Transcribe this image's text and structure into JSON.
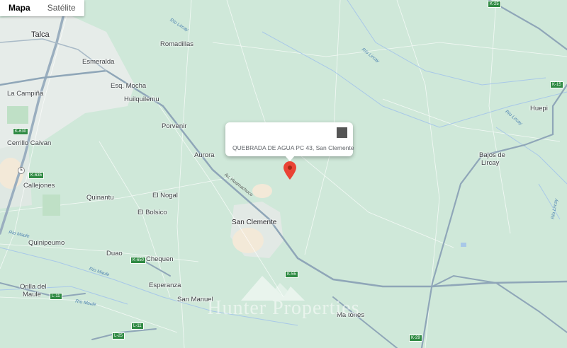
{
  "map_type": {
    "options": [
      "Mapa",
      "Satélite"
    ],
    "selected": "Mapa"
  },
  "info_window": {
    "text": "QUEBRADA DE AGUA PC 43, San Clemente"
  },
  "marker": {
    "color": "#ea4335"
  },
  "watermark": {
    "text": "Hunter Properties"
  },
  "places": {
    "talca": "Talca",
    "romadillas": "Romadillas",
    "esmeralda": "Esmeralda",
    "esq_mocha": "Esq. Mocha",
    "la_campina": "La Campiña",
    "huilquilemu": "Huilquilemu",
    "porvenir": "Porvenir",
    "cerrillo": "Cerrillo Caivan",
    "aurora": "Aurora",
    "huepi": "Huepi",
    "bajos": "Bajos de",
    "lircay": "Lircay",
    "callejones": "Callejones",
    "el_nogal": "El Nogal",
    "quinantu": "Quinantu",
    "el_bolsico": "El Bolsico",
    "san_clemente": "San Clemente",
    "quinipeumo": "Quinipeumo",
    "duao": "Duao",
    "chequen": "Chequen",
    "esperanza": "Esperanza",
    "orilla_del": "Orilla del",
    "maule": "Maule",
    "san_manuel": "San Manuel",
    "matones": "Ma tones"
  },
  "rivers": {
    "lircay1": "Río Lircay",
    "lircay2": "Río Lircay",
    "lircay3": "Río Lircay",
    "lircay4": "Río Lircay",
    "maule1": "Río Maule",
    "maule2": "Río Maule",
    "maule3": "Río Maule"
  },
  "roads": {
    "huamachuco": "Av. Huamachuco"
  },
  "shields": {
    "k25": "K-25",
    "k15": "K-15",
    "k630": "K-630",
    "k635": "K-635",
    "r5": "5",
    "k650": "K-650",
    "l11a": "L-11",
    "l11b": "L-11",
    "l25": "L-25",
    "k55": "K-55",
    "k29": "K-29"
  },
  "colors": {
    "land": "#cfe8d9",
    "urban": "#eaeeed",
    "road_major": "#8fa6b8",
    "water": "#a8c8e8"
  }
}
